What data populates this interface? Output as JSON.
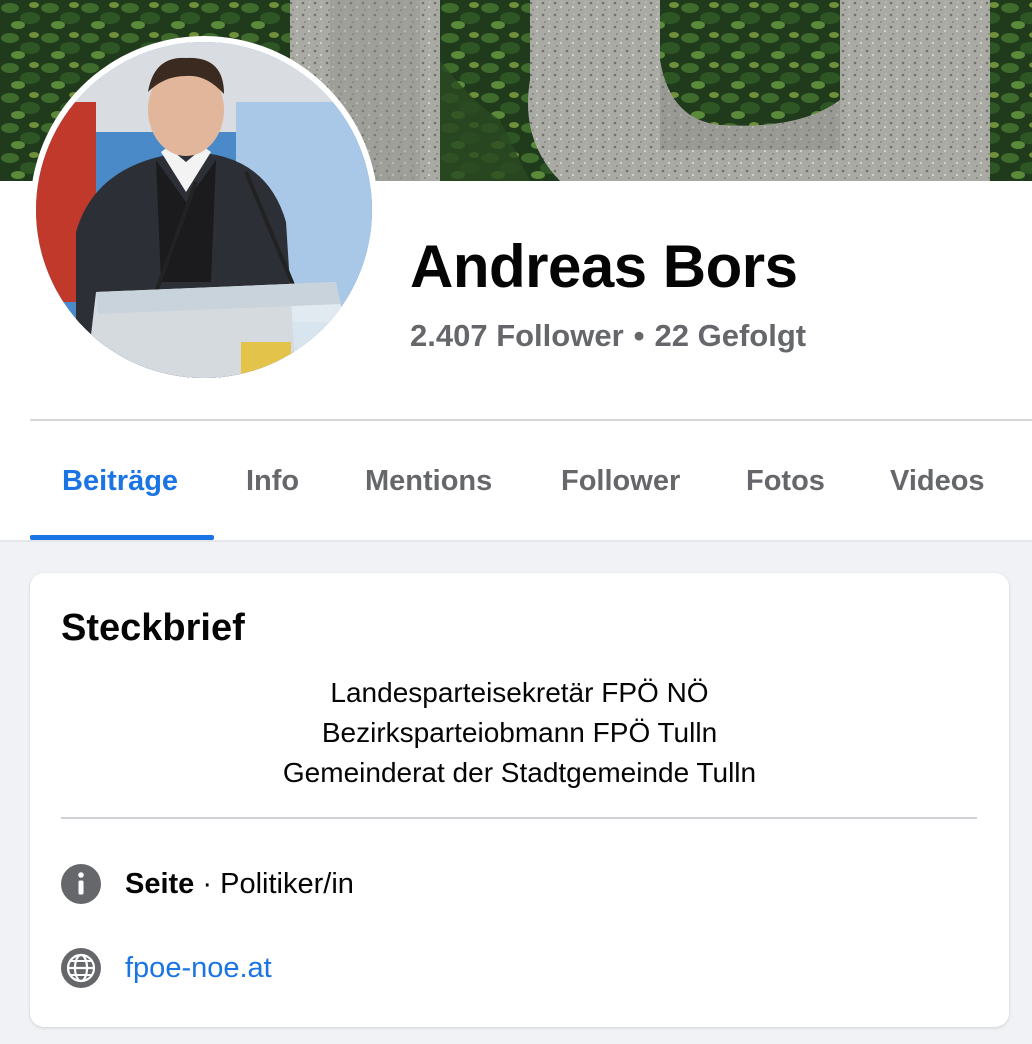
{
  "profile": {
    "name": "Andreas Bors",
    "followers": "2.407 Follower",
    "separator": "•",
    "following": "22 Gefolgt"
  },
  "tabs": [
    {
      "label": "Beiträge",
      "active": true
    },
    {
      "label": "Info",
      "active": false
    },
    {
      "label": "Mentions",
      "active": false
    },
    {
      "label": "Follower",
      "active": false
    },
    {
      "label": "Fotos",
      "active": false
    },
    {
      "label": "Videos",
      "active": false
    }
  ],
  "card": {
    "title": "Steckbrief",
    "bio_lines": [
      "Landesparteisekretär FPÖ NÖ",
      "Bezirksparteiobmann FPÖ Tulln",
      "Gemeinderat der Stadtgemeinde Tulln"
    ],
    "category": {
      "icon": "info-icon",
      "label": "Seite",
      "separator": "·",
      "value": "Politiker/in"
    },
    "website": {
      "icon": "globe-icon",
      "text": "fpoe-noe.at"
    }
  },
  "colors": {
    "accent": "#1b74e4",
    "text_primary": "#050505",
    "text_secondary": "#65676b",
    "background": "#f0f2f5"
  }
}
